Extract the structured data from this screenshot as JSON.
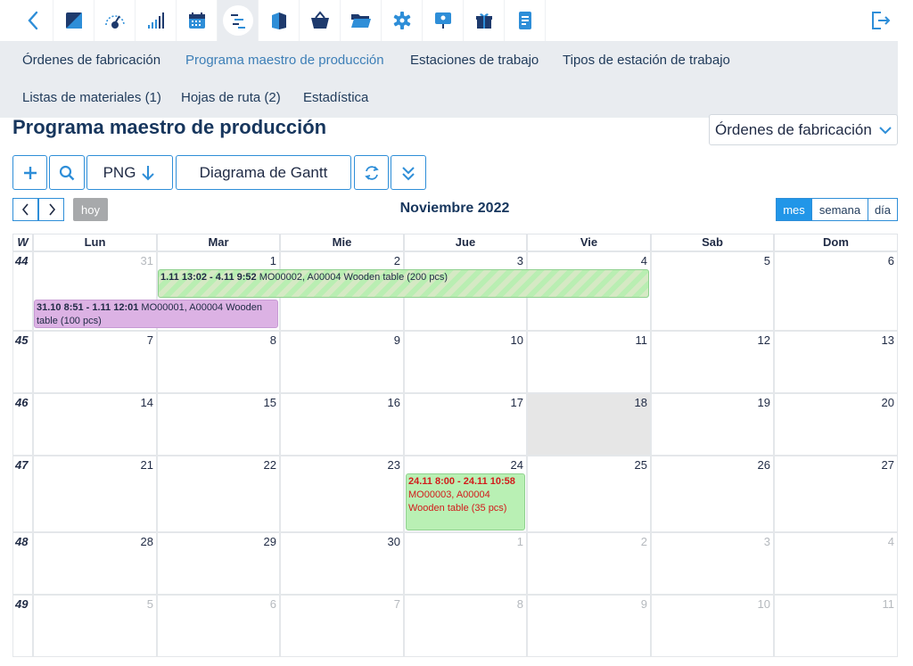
{
  "toolbar": {
    "back_icon": "chevron-left-icon",
    "items": [
      {
        "icon": "square-split-icon"
      },
      {
        "icon": "gauge-icon"
      },
      {
        "icon": "signal-bars-icon"
      },
      {
        "icon": "calendar-icon"
      },
      {
        "icon": "gantt-lines-icon"
      },
      {
        "icon": "book-icon"
      },
      {
        "icon": "basket-icon"
      },
      {
        "icon": "folder-open-icon"
      },
      {
        "icon": "gear-icon"
      },
      {
        "icon": "presentation-icon"
      },
      {
        "icon": "gift-icon"
      },
      {
        "icon": "document-icon"
      }
    ],
    "logout_icon": "logout-icon"
  },
  "submenu": {
    "row1": [
      "Órdenes de fabricación",
      "Programa maestro de producción",
      "Estaciones de trabajo",
      "Tipos de estación de trabajo"
    ],
    "row2": [
      "Listas de materiales (1)",
      "Hojas de ruta (2)",
      "Estadística"
    ],
    "active": "Programa maestro de producción"
  },
  "page": {
    "title": "Programa maestro de producción",
    "select_value": "Órdenes de fabricación"
  },
  "actions": {
    "png_label": "PNG",
    "gantt_label": "Diagrama de Gantt"
  },
  "calendar": {
    "today_label": "hoy",
    "month_title": "Noviembre 2022",
    "views": [
      "mes",
      "semana",
      "día"
    ],
    "selected_view": "mes",
    "week_header": "W",
    "day_headers": [
      "Lun",
      "Mar",
      "Mie",
      "Jue",
      "Vie",
      "Sab",
      "Dom"
    ],
    "weeks": [
      {
        "number": "44",
        "days": [
          "31",
          "1",
          "2",
          "3",
          "4",
          "5",
          "6"
        ]
      },
      {
        "number": "45",
        "days": [
          "7",
          "8",
          "9",
          "10",
          "11",
          "12",
          "13"
        ]
      },
      {
        "number": "46",
        "days": [
          "14",
          "15",
          "16",
          "17",
          "18",
          "19",
          "20"
        ]
      },
      {
        "number": "47",
        "days": [
          "21",
          "22",
          "23",
          "24",
          "25",
          "26",
          "27"
        ]
      },
      {
        "number": "48",
        "days": [
          "28",
          "29",
          "30",
          "1",
          "2",
          "3",
          "4"
        ]
      },
      {
        "number": "49",
        "days": [
          "5",
          "6",
          "7",
          "8",
          "9",
          "10",
          "11"
        ]
      }
    ],
    "events": [
      {
        "time": "1.11 13:02 - 4.11 9:52",
        "text": " MO00002, A00004 Wooden table (200 pcs)"
      },
      {
        "time": "31.10 8:51 - 1.11 12:01",
        "text": " MO00001, A00004 Wooden table (100 pcs)"
      },
      {
        "time": "24.11 8:00 - 24.11 10:58",
        "text": " MO00003, A00004 Wooden table (35 pcs)"
      }
    ]
  }
}
